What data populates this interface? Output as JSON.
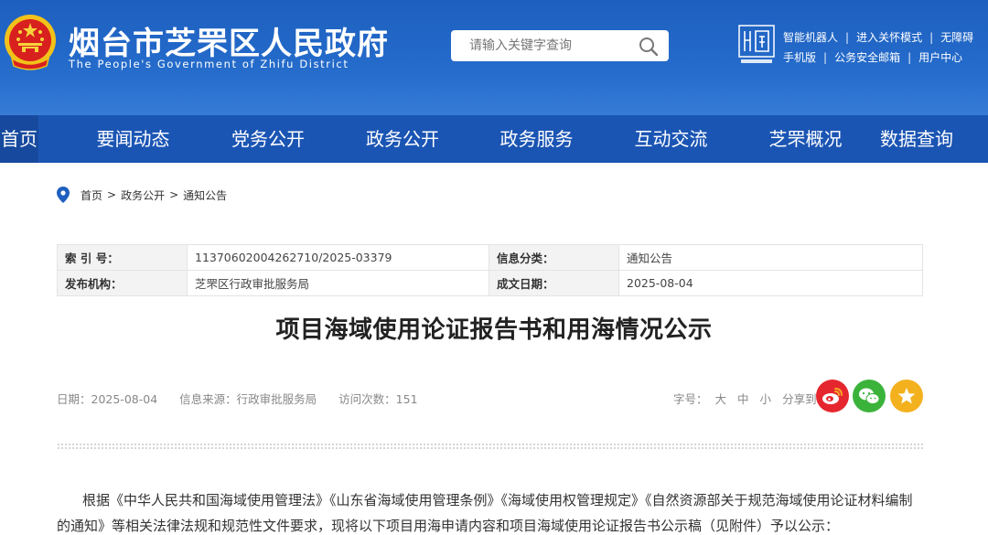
{
  "header": {
    "site_title": "烟台市芝罘区人民政府",
    "site_subtitle": "The People's Government of Zhifu District",
    "search_placeholder": "请输入关键字查询",
    "top_links_row1": [
      "智能机器人",
      "进入关怀模式",
      "无障碍"
    ],
    "top_links_row2": [
      "手机版",
      "公务安全邮箱",
      "用户中心"
    ]
  },
  "nav": {
    "items": [
      "首页",
      "要闻动态",
      "党务公开",
      "政务公开",
      "政务服务",
      "互动交流",
      "芝罘概况",
      "数据查询"
    ]
  },
  "breadcrumb": [
    "首页",
    "政务公开",
    "通知公告"
  ],
  "meta": {
    "index_label": "索 引 号：",
    "index_value": "11370602004262710/2025-03379",
    "category_label": "信息分类：",
    "category_value": "通知公告",
    "publisher_label": "发布机构：",
    "publisher_value": "芝罘区行政审批服务局",
    "date_label": "成文日期：",
    "date_value": "2025-08-04"
  },
  "article": {
    "title": "项目海域使用论证报告书和用海情况公示",
    "date": "日期：2025-08-04",
    "source": "信息来源：行政审批服务局",
    "visits": "访问次数：151",
    "font_size_label": "字号：",
    "font_sizes": [
      "大",
      "中",
      "小"
    ],
    "share_label": "分享到：",
    "body": "根据《中华人民共和国海域使用管理法》《山东省海域使用管理条例》《海域使用权管理规定》《自然资源部关于规范海域使用论证材料编制的通知》等相关法律法规和规范性文件要求，现将以下项目用海申请内容和项目海域使用论证报告书公示稿（见附件）予以公示："
  },
  "colors": {
    "header_blue": "#2a74d3",
    "nav_blue": "#1b55b4",
    "weibo": "#e6262e",
    "wechat": "#3bb33b",
    "favorite": "#f3b11e"
  }
}
